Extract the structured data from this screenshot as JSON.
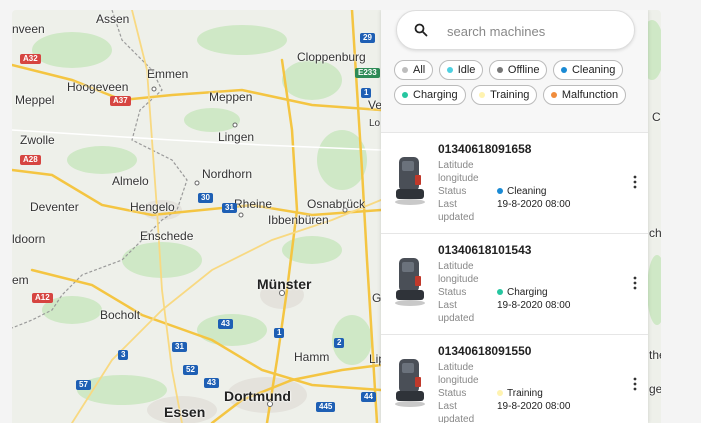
{
  "colors": {
    "all": "#bdbdbd",
    "idle": "#4dd0e1",
    "offline": "#777777",
    "cleaning": "#1a8ad4",
    "charging": "#26c6a0",
    "training": "#fff3b0",
    "malfunction": "#f08c3c"
  },
  "search": {
    "placeholder": "search machines"
  },
  "filters": [
    {
      "label": "All",
      "color_key": "all"
    },
    {
      "label": "Idle",
      "color_key": "idle"
    },
    {
      "label": "Offline",
      "color_key": "offline"
    },
    {
      "label": "Cleaning",
      "color_key": "cleaning"
    },
    {
      "label": "Charging",
      "color_key": "charging"
    },
    {
      "label": "Training",
      "color_key": "training"
    },
    {
      "label": "Malfunction",
      "color_key": "malfunction"
    }
  ],
  "field_labels": {
    "latitude": "Latitude",
    "longitude": "longitude",
    "status": "Status",
    "last": "Last",
    "updated": "updated"
  },
  "machines": [
    {
      "id": "01340618091658",
      "status": "Cleaning",
      "status_color": "#1a8ad4",
      "updated": "19-8-2020 08:00"
    },
    {
      "id": "01340618101543",
      "status": "Charging",
      "status_color": "#26c6a0",
      "updated": "19-8-2020 08:00"
    },
    {
      "id": "01340618091550",
      "status": "Training",
      "status_color": "#fff3b0",
      "updated": "19-8-2020 08:00"
    }
  ],
  "map": {
    "labels": [
      "Assen",
      "nveen",
      "Emmen",
      "Hoogeveen",
      "Meppel",
      "Meppen",
      "Cloppenburg",
      "Ve",
      "Lo",
      "Zwolle",
      "Lingen",
      "Nordhorn",
      "Almelo",
      "Deventer",
      "Hengelo",
      "Rheine",
      "Osnabrück",
      "Ibbenbüren",
      "Enschede",
      "ldoorn",
      "Münster",
      "em",
      "Bocholt",
      "Hamm",
      "Lip",
      "Dortmund",
      "Essen",
      "G",
      "Ce",
      "che",
      "the",
      "ger"
    ],
    "cities": [
      "Münster",
      "Dortmund",
      "Essen"
    ],
    "road_badges": [
      {
        "text": "A32",
        "color": "#d64541"
      },
      {
        "text": "A37",
        "color": "#d64541"
      },
      {
        "text": "29",
        "color": "#1e5fb4"
      },
      {
        "text": "E233",
        "color": "#2e8b57"
      },
      {
        "text": "1",
        "color": "#1e5fb4"
      },
      {
        "text": "A28",
        "color": "#d64541"
      },
      {
        "text": "30",
        "color": "#1e5fb4"
      },
      {
        "text": "31",
        "color": "#1e5fb4"
      },
      {
        "text": "43",
        "color": "#1e5fb4"
      },
      {
        "text": "A12",
        "color": "#d64541"
      },
      {
        "text": "1",
        "color": "#1e5fb4"
      },
      {
        "text": "31",
        "color": "#1e5fb4"
      },
      {
        "text": "3",
        "color": "#1e5fb4"
      },
      {
        "text": "52",
        "color": "#1e5fb4"
      },
      {
        "text": "2",
        "color": "#1e5fb4"
      },
      {
        "text": "43",
        "color": "#1e5fb4"
      },
      {
        "text": "57",
        "color": "#1e5fb4"
      },
      {
        "text": "445",
        "color": "#1e5fb4"
      },
      {
        "text": "44",
        "color": "#1e5fb4"
      }
    ]
  }
}
